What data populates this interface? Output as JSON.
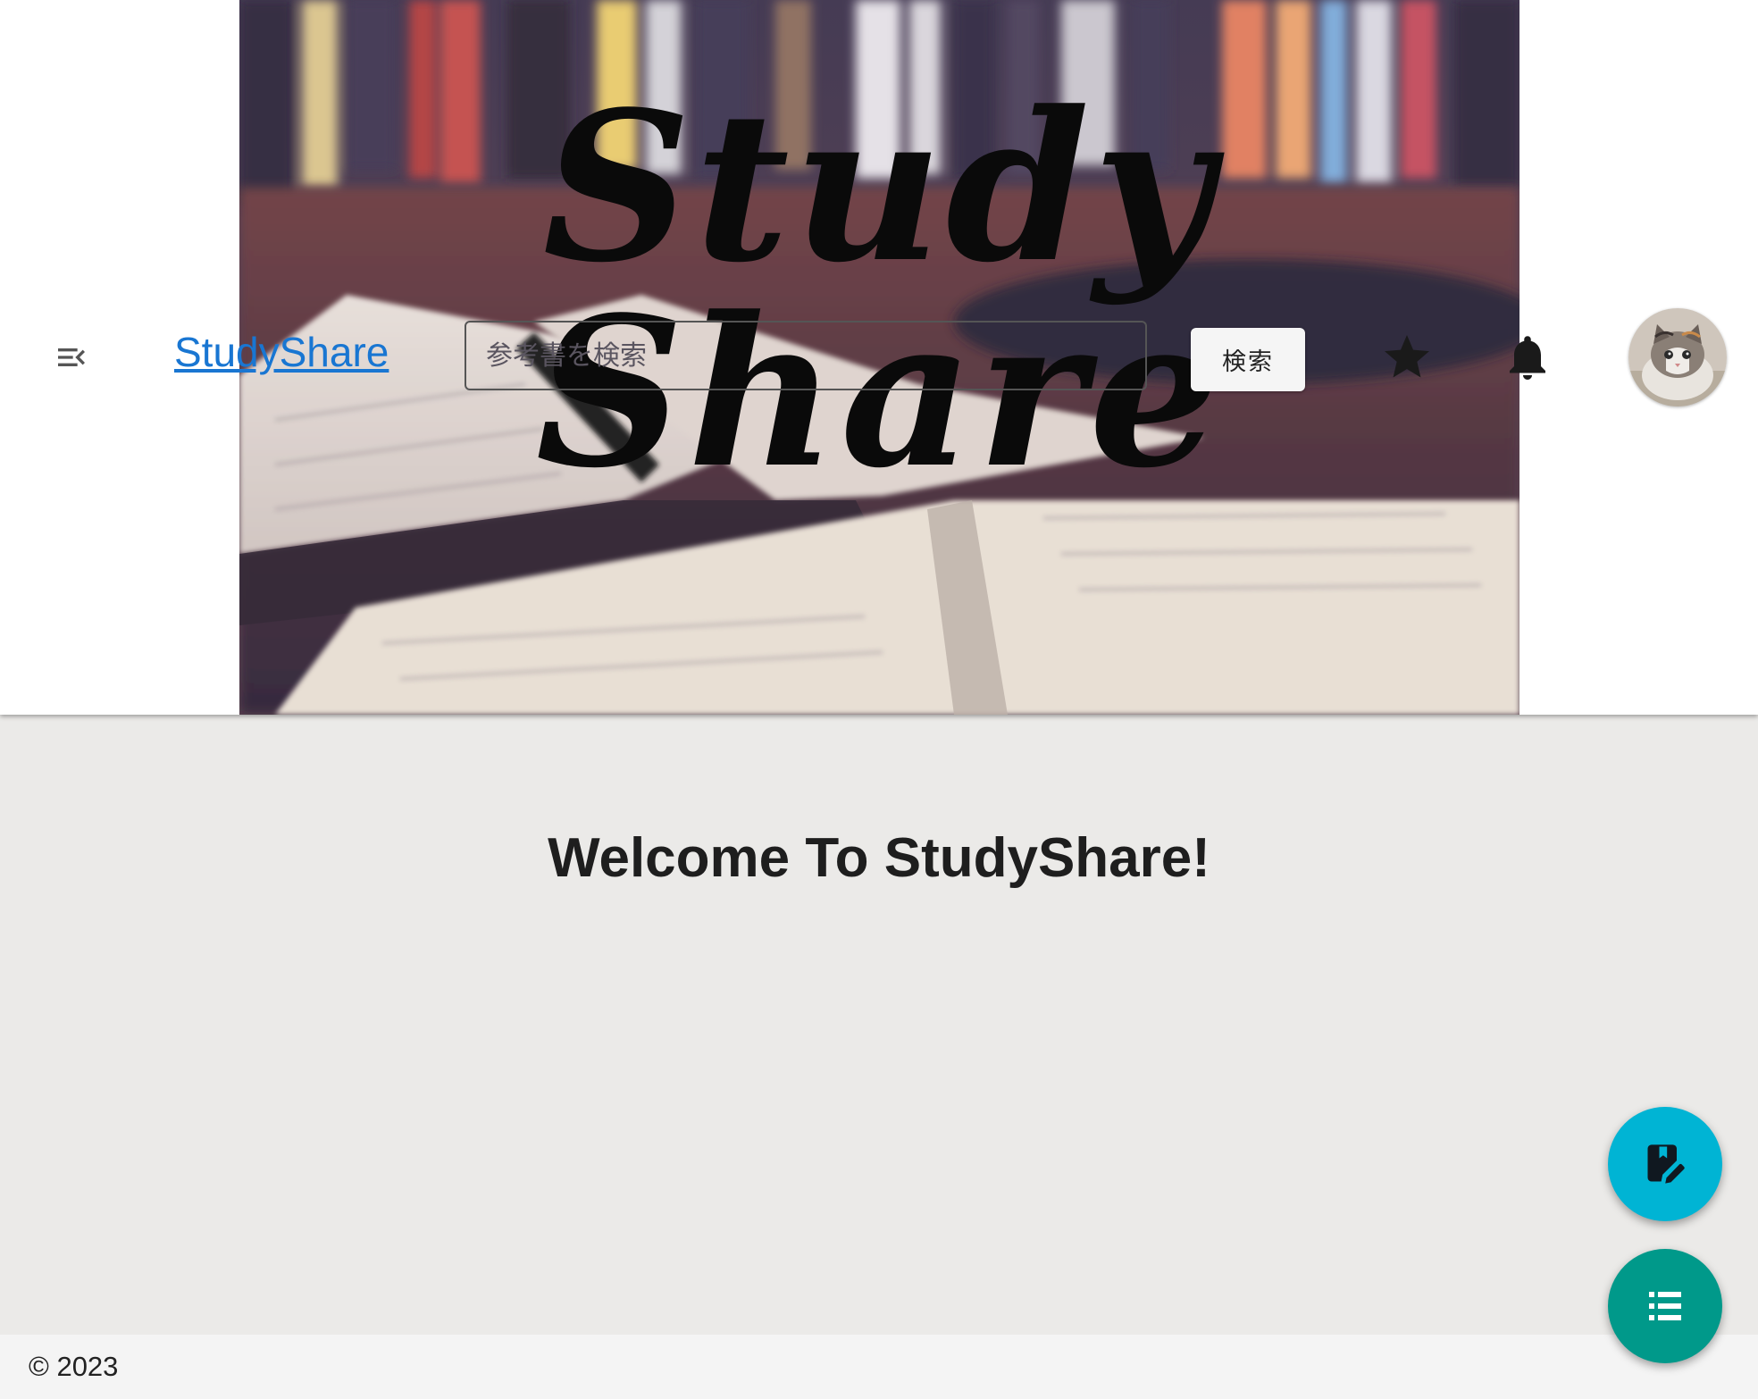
{
  "header": {
    "banner_title": "Study Share",
    "brand": "StudyShare",
    "search": {
      "placeholder": "参考書を検索",
      "value": ""
    },
    "search_button": "検索"
  },
  "main": {
    "welcome": "Welcome To StudyShare!"
  },
  "footer": {
    "copyright": "© 2023"
  },
  "colors": {
    "brand_link": "#1976d2",
    "fab_edit": "#00b4d4",
    "fab_list": "#00998a"
  },
  "icons": {
    "menu": "menu-open-icon",
    "star": "star-icon",
    "bell": "bell-icon",
    "edit": "book-edit-icon",
    "list": "list-icon"
  }
}
